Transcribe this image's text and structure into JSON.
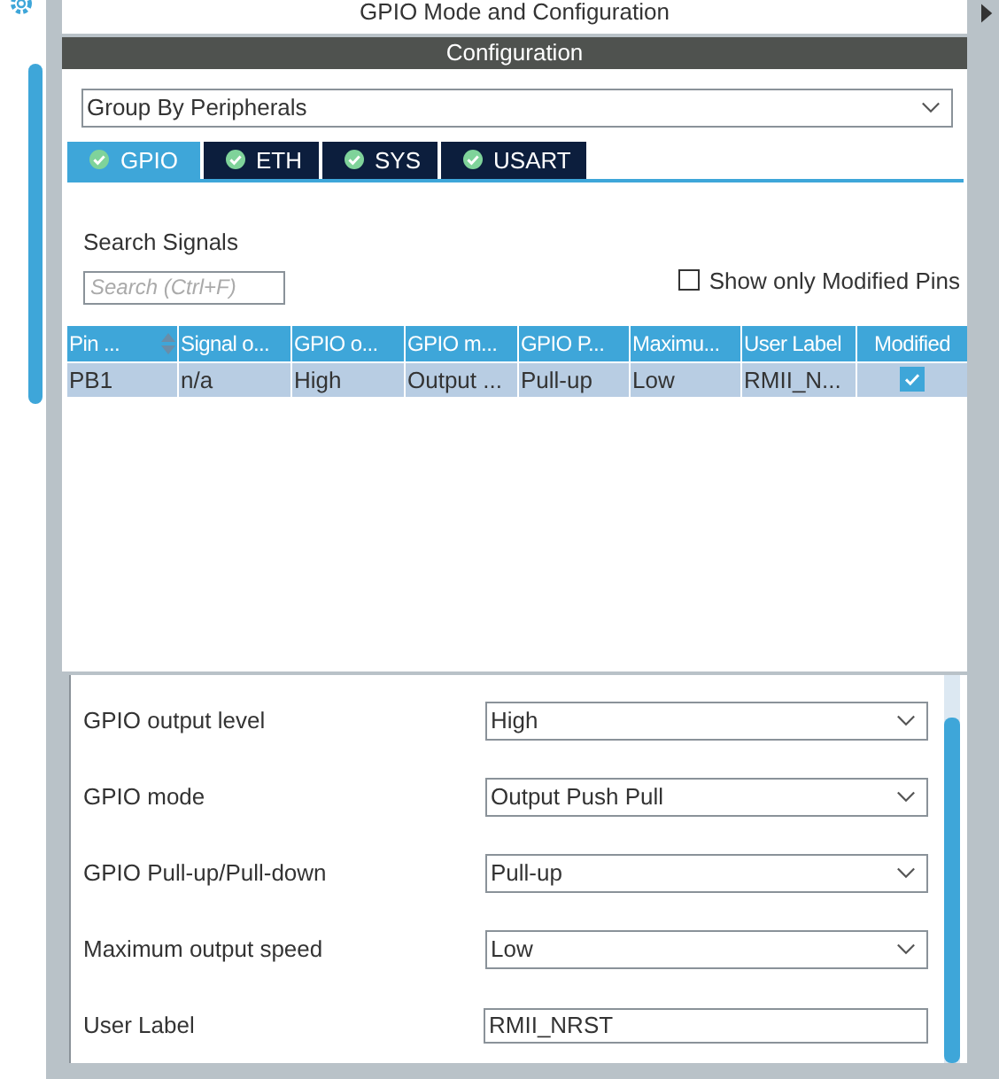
{
  "panel_title": "GPIO Mode and Configuration",
  "section_title": "Configuration",
  "group_by": {
    "value": "Group By Peripherals"
  },
  "tabs": [
    {
      "label": "GPIO",
      "selected": true
    },
    {
      "label": "ETH",
      "selected": false
    },
    {
      "label": "SYS",
      "selected": false
    },
    {
      "label": "USART",
      "selected": false
    }
  ],
  "search": {
    "label": "Search Signals",
    "placeholder": "Search (Ctrl+F)"
  },
  "show_only_modified": {
    "label": "Show only Modified Pins",
    "checked": false
  },
  "table": {
    "columns": [
      "Pin ...",
      "Signal o...",
      "GPIO o...",
      "GPIO m...",
      "GPIO P...",
      "Maximu...",
      "User Label",
      "Modified"
    ],
    "rows": [
      {
        "cells": [
          "PB1",
          "n/a",
          "High",
          "Output ...",
          "Pull-up",
          "Low",
          "RMII_N..."
        ],
        "modified": true,
        "selected": true
      }
    ]
  },
  "settings": [
    {
      "label": "GPIO output level",
      "kind": "select",
      "value": "High"
    },
    {
      "label": "GPIO mode",
      "kind": "select",
      "value": "Output Push Pull"
    },
    {
      "label": "GPIO Pull-up/Pull-down",
      "kind": "select",
      "value": "Pull-up"
    },
    {
      "label": "Maximum output speed",
      "kind": "select",
      "value": "Low"
    },
    {
      "label": "User Label",
      "kind": "text",
      "value": "RMII_NRST"
    }
  ]
}
